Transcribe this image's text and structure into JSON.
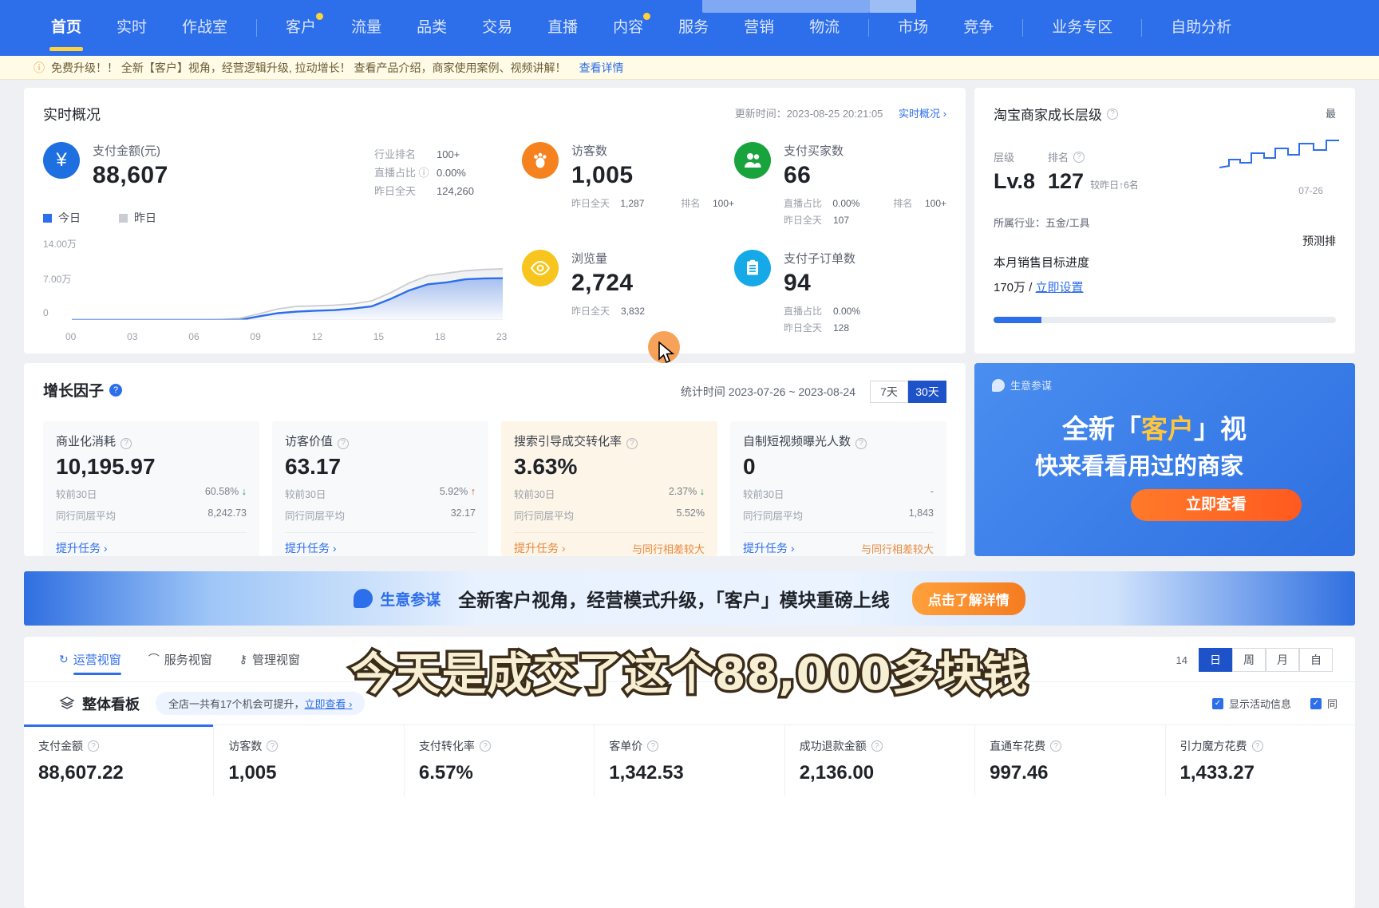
{
  "nav": {
    "items": [
      {
        "label": "首页",
        "active": true,
        "dot": false
      },
      {
        "label": "实时",
        "active": false,
        "dot": false
      },
      {
        "label": "作战室",
        "active": false,
        "dot": false
      },
      {
        "sep": true
      },
      {
        "label": "客户",
        "active": false,
        "dot": true
      },
      {
        "label": "流量",
        "active": false,
        "dot": false
      },
      {
        "label": "品类",
        "active": false,
        "dot": false
      },
      {
        "label": "交易",
        "active": false,
        "dot": false
      },
      {
        "label": "直播",
        "active": false,
        "dot": false
      },
      {
        "label": "内容",
        "active": false,
        "dot": true
      },
      {
        "label": "服务",
        "active": false,
        "dot": false
      },
      {
        "label": "营销",
        "active": false,
        "dot": false
      },
      {
        "label": "物流",
        "active": false,
        "dot": false
      },
      {
        "sep": true
      },
      {
        "label": "市场",
        "active": false,
        "dot": false
      },
      {
        "label": "竞争",
        "active": false,
        "dot": false
      },
      {
        "sep": true
      },
      {
        "label": "业务专区",
        "active": false,
        "dot": false
      },
      {
        "sep": true
      },
      {
        "label": "自助分析",
        "active": false,
        "dot": false
      }
    ]
  },
  "notice": {
    "icon": "info-icon",
    "text": "免费升级！！ 全新【客户】视角，经营逻辑升级, 拉动增长！ 查看产品介绍，商家使用案例、视频讲解！",
    "link": "查看详情"
  },
  "realtime": {
    "title": "实时概况",
    "update_label": "更新时间：2023-08-25 20:21:05",
    "link": "实时概况 ›",
    "payment": {
      "icon": "yen-icon",
      "label": "支付金额(元)",
      "value": "88,607",
      "stats": [
        {
          "k": "行业排名",
          "v": "100+"
        },
        {
          "k": "直播占比 ⓘ",
          "v": "0.00%"
        },
        {
          "k": "昨日全天",
          "v": "124,260"
        }
      ]
    },
    "legend": [
      {
        "label": "今日",
        "color": "#2d6eea"
      },
      {
        "label": "昨日",
        "color": "#c9ccd1"
      }
    ],
    "metrics": [
      {
        "icon": "footprint-icon",
        "color": "orange",
        "label": "访客数",
        "value": "1,005",
        "sub": [
          {
            "k": "昨日全天",
            "v": "1,287",
            "k2": "排名",
            "v2": "100+"
          }
        ]
      },
      {
        "icon": "users-icon",
        "color": "green",
        "label": "支付买家数",
        "value": "66",
        "sub": [
          {
            "k": "直播占比",
            "v": "0.00%",
            "k2": "排名",
            "v2": "100+"
          },
          {
            "k": "昨日全天",
            "v": "107"
          }
        ]
      },
      {
        "icon": "eye-icon",
        "color": "yellow",
        "label": "浏览量",
        "value": "2,724",
        "sub": [
          {
            "k": "昨日全天",
            "v": "3,832"
          }
        ]
      },
      {
        "icon": "clipboard-icon",
        "color": "cyan",
        "label": "支付子订单数",
        "value": "94",
        "sub": [
          {
            "k": "直播占比",
            "v": "0.00%"
          },
          {
            "k": "昨日全天",
            "v": "128"
          }
        ]
      }
    ]
  },
  "chart_data": {
    "type": "area",
    "title": "实时概况 支付金额趋势",
    "xlabel": "",
    "ylabel": "",
    "x": [
      "00",
      "03",
      "06",
      "09",
      "12",
      "15",
      "18",
      "23"
    ],
    "tick_labels": [
      "00",
      "03",
      "06",
      "09",
      "12",
      "15",
      "18",
      "23"
    ],
    "ytick_labels": [
      "14.00万",
      "7.00万",
      "0"
    ],
    "ylim": [
      0,
      140000
    ],
    "grid": false,
    "legend_position": "top-left",
    "series": [
      {
        "name": "今日",
        "color": "#2d6eea",
        "values": [
          0,
          0,
          0,
          0,
          0,
          0,
          0,
          0,
          0,
          200,
          6000,
          11000,
          13500,
          15000,
          16000,
          18500,
          22000,
          34000,
          48000,
          58000,
          61000,
          66000,
          67500,
          67800
        ]
      },
      {
        "name": "昨日",
        "color": "#c9ccd1",
        "values": [
          0,
          0,
          0,
          0,
          0,
          0,
          0,
          0,
          600,
          3000,
          10000,
          18000,
          22000,
          23000,
          24000,
          26000,
          31000,
          44000,
          60000,
          72000,
          76000,
          80000,
          82000,
          83000
        ]
      }
    ]
  },
  "growth": {
    "title": "增长因子",
    "help_icon": "question-icon",
    "range_label": "统计时间 2023-07-26 ~ 2023-08-24",
    "segments": [
      {
        "label": "7天",
        "on": false
      },
      {
        "label": "30天",
        "on": true
      }
    ],
    "cards": [
      {
        "label": "商业化消耗",
        "value": "10,195.97",
        "warn": false,
        "cmp_label": "较前30日",
        "cmp_value": "60.58%",
        "cmp_dir": "down",
        "peer_label": "同行同层平均",
        "peer_value": "8,242.73",
        "link": "提升任务 ›",
        "tag": ""
      },
      {
        "label": "访客价值",
        "value": "63.17",
        "warn": false,
        "cmp_label": "较前30日",
        "cmp_value": "5.92%",
        "cmp_dir": "up",
        "peer_label": "同行同层平均",
        "peer_value": "32.17",
        "link": "提升任务 ›",
        "tag": ""
      },
      {
        "label": "搜索引导成交转化率",
        "value": "3.63%",
        "warn": true,
        "cmp_label": "较前30日",
        "cmp_value": "2.37%",
        "cmp_dir": "down",
        "peer_label": "同行同层平均",
        "peer_value": "5.52%",
        "link": "提升任务 ›",
        "tag": "与同行相差较大"
      },
      {
        "label": "自制短视频曝光人数",
        "value": "0",
        "warn": false,
        "cmp_label": "较前30日",
        "cmp_value": "-",
        "cmp_dir": "none",
        "peer_label": "同行同层平均",
        "peer_value": "1,843",
        "link": "提升任务 ›",
        "tag": "与同行相差较大"
      }
    ]
  },
  "level": {
    "title": "淘宝商家成长层级",
    "help_icon": "question-icon",
    "head_tier": "层级",
    "head_rank": "排名",
    "tier": "Lv.8",
    "rank": "127",
    "delta": "较昨日↑6名",
    "industry": "所属行业：五金/工具",
    "goal_title": "本月销售目标进度",
    "goal_value": "170万 /",
    "goal_link": "立即设置",
    "side_label": "最",
    "forecast_label": "预测排",
    "spark_date": "07-26"
  },
  "promo": {
    "brand": "生意参谋",
    "line1_a": "全新「",
    "line1_b": "客户",
    "line1_c": "」视",
    "line2": "快来看看用过的商家",
    "button": "立即查看"
  },
  "wide_banner": {
    "brand": "生意参谋",
    "text": "全新客户视角，经营模式升级，「客户」模块重磅上线",
    "button": "点击了解详情"
  },
  "bottom": {
    "views": [
      {
        "label": "运营视窗",
        "icon": "refresh-icon",
        "on": true
      },
      {
        "label": "服务视窗",
        "icon": "headset-icon",
        "on": false
      },
      {
        "label": "管理视窗",
        "icon": "key-icon",
        "on": false
      }
    ],
    "time_date": "14",
    "time_segments": [
      {
        "label": "日",
        "on": true
      },
      {
        "label": "周",
        "on": false
      },
      {
        "label": "月",
        "on": false
      },
      {
        "label": "自",
        "on": false
      }
    ],
    "board_title": "整体看板",
    "board_icon": "layers-icon",
    "board_pill_text": "全店一共有17个机会可提升，",
    "board_pill_link": "立即查看 ›",
    "checkboxes": [
      {
        "label": "显示活动信息",
        "checked": true
      },
      {
        "label": "同",
        "checked": true
      }
    ],
    "metrics": [
      {
        "label": "支付金额",
        "value": "88,607.22",
        "selected": true
      },
      {
        "label": "访客数",
        "value": "1,005",
        "selected": false
      },
      {
        "label": "支付转化率",
        "value": "6.57%",
        "selected": false
      },
      {
        "label": "客单价",
        "value": "1,342.53",
        "selected": false
      },
      {
        "label": "成功退款金额",
        "value": "2,136.00",
        "selected": false
      },
      {
        "label": "直通车花费",
        "value": "997.46",
        "selected": false
      },
      {
        "label": "引力魔方花费",
        "value": "1,433.27",
        "selected": false
      }
    ]
  },
  "subtitle": {
    "text": "今天是成交了这个88,000多块钱"
  },
  "colors": {
    "brand_blue": "#2d6eea",
    "accent_yellow": "#ffd13b",
    "up_red": "#e8402a",
    "down_green": "#0a9e4e",
    "warn_orange": "#e8883d"
  }
}
